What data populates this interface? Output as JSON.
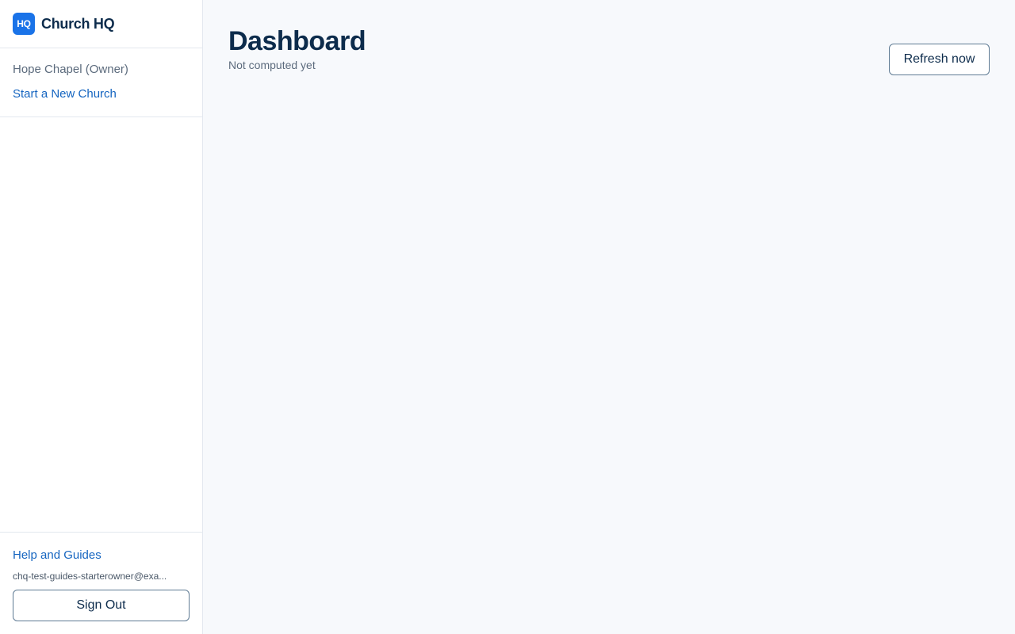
{
  "brand": {
    "logo_text": "HQ",
    "name": "Church HQ"
  },
  "church": {
    "current": "Hope Chapel (Owner)",
    "new_church_link": "Start a New Church"
  },
  "footer": {
    "help_link": "Help and Guides",
    "user_email": "chq-test-guides-starterowner@exa...",
    "sign_out_label": "Sign Out"
  },
  "main": {
    "title": "Dashboard",
    "subtitle": "Not computed yet",
    "refresh_label": "Refresh now"
  },
  "colors": {
    "accent": "#1a73e8",
    "link": "#1565c0",
    "heading": "#0d2c4c",
    "background": "#f7f9fc"
  }
}
